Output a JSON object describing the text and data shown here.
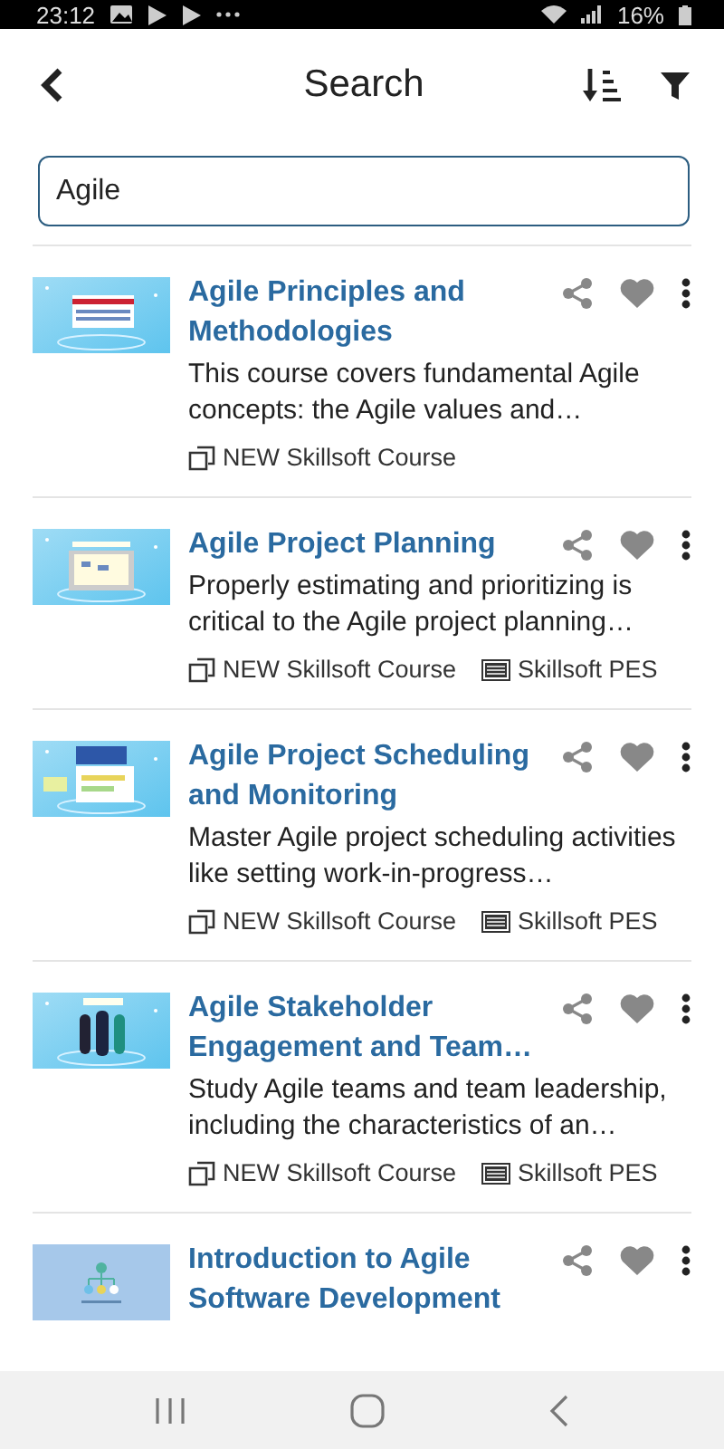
{
  "status_bar": {
    "time": "23:12",
    "battery": "16%"
  },
  "header": {
    "title": "Search"
  },
  "search": {
    "value": "Agile"
  },
  "results": [
    {
      "title": "Agile Principles and Methodologies",
      "description": "This course covers fundamental Agile concepts: the Agile values and…",
      "tags": [
        {
          "kind": "course",
          "label": "NEW Skillsoft Course"
        }
      ]
    },
    {
      "title": "Agile Project Planning",
      "description": "Properly estimating and prioritizing is critical to the Agile project planning…",
      "tags": [
        {
          "kind": "course",
          "label": "NEW Skillsoft Course"
        },
        {
          "kind": "pes",
          "label": "Skillsoft PES"
        }
      ]
    },
    {
      "title": "Agile Project Scheduling and Monitoring",
      "description": "Master Agile project scheduling activities like setting work-in-progress…",
      "tags": [
        {
          "kind": "course",
          "label": "NEW Skillsoft Course"
        },
        {
          "kind": "pes",
          "label": "Skillsoft PES"
        }
      ]
    },
    {
      "title": "Agile Stakeholder Engagement and Team…",
      "description": "Study Agile teams and team leadership, including the characteristics of an…",
      "tags": [
        {
          "kind": "course",
          "label": "NEW Skillsoft Course"
        },
        {
          "kind": "pes",
          "label": "Skillsoft PES"
        }
      ]
    },
    {
      "title": "Introduction to Agile Software Development"
    }
  ]
}
